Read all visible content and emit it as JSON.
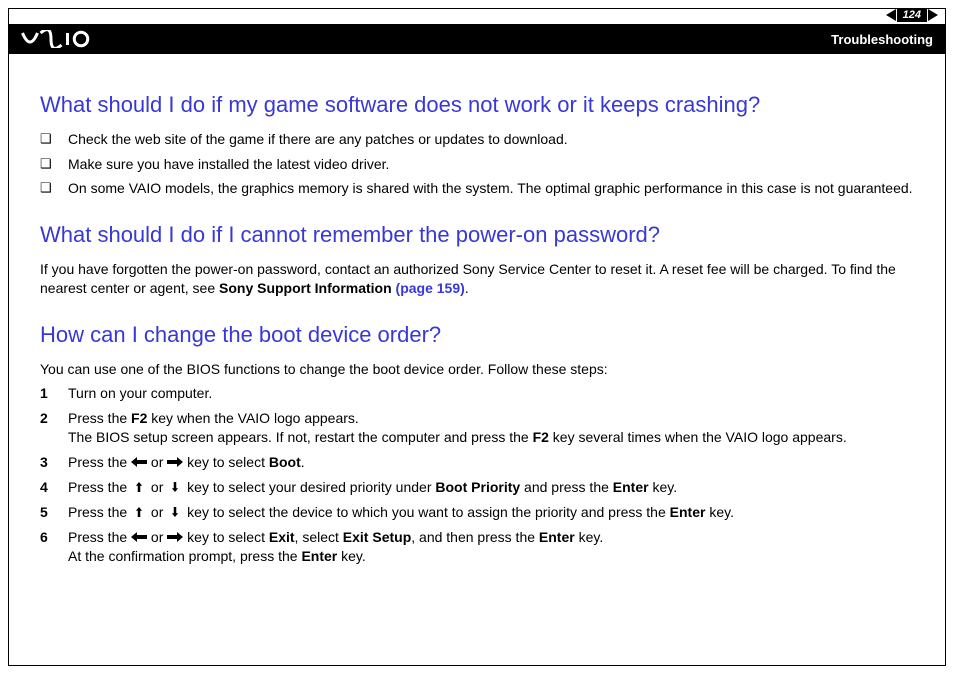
{
  "header": {
    "page_number": "124",
    "section": "Troubleshooting"
  },
  "sections": [
    {
      "heading": "What should I do if my game software does not work or it keeps crashing?",
      "bullets": [
        "Check the web site of the game if there are any patches or updates to download.",
        "Make sure you have installed the latest video driver.",
        "On some VAIO models, the graphics memory is shared with the system. The optimal graphic performance in this case is not guaranteed."
      ]
    },
    {
      "heading": "What should I do if I cannot remember the power-on password?",
      "para_parts": {
        "t1": "If you have forgotten the power-on password, contact an authorized Sony Service Center to reset it. A reset fee will be charged. To find the nearest center or agent, see ",
        "bold1": "Sony Support Information",
        "link1": " (page 159)",
        "t2": "."
      }
    },
    {
      "heading": "How can I change the boot device order?",
      "intro": "You can use one of the BIOS functions to change the boot device order. Follow these steps:",
      "steps": {
        "s1": "Turn on your computer.",
        "s2a": "Press the ",
        "s2b": "F2",
        "s2c": " key when the VAIO logo appears.",
        "s2d": "The BIOS setup screen appears. If not, restart the computer and press the ",
        "s2e": "F2",
        "s2f": " key several times when the VAIO logo appears.",
        "s3a": "Press the ",
        "s3or": " or ",
        "s3b": " key to select ",
        "s3c": "Boot",
        "s3d": ".",
        "s4a": "Press the ",
        "s4or": " or ",
        "s4b": " key to select your desired priority under ",
        "s4c": "Boot Priority",
        "s4d": " and press the ",
        "s4e": "Enter",
        "s4f": " key.",
        "s5a": "Press the ",
        "s5or": " or ",
        "s5b": " key to select the device to which you want to assign the priority and press the ",
        "s5c": "Enter",
        "s5d": " key.",
        "s6a": "Press the ",
        "s6or": " or ",
        "s6b": " key to select ",
        "s6c": "Exit",
        "s6d": ", select ",
        "s6e": "Exit Setup",
        "s6f": ", and then press the ",
        "s6g": "Enter",
        "s6h": " key.",
        "s6i": "At the confirmation prompt, press the ",
        "s6j": "Enter",
        "s6k": " key."
      }
    }
  ]
}
